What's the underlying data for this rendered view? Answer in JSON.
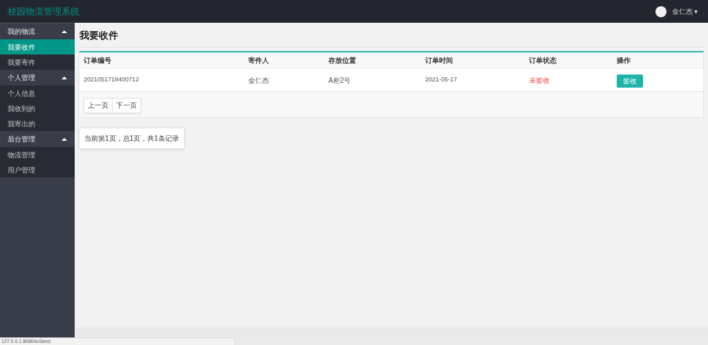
{
  "header": {
    "title": "校园物流管理系统",
    "user": "金仁杰",
    "caret": "▾"
  },
  "sidebar": {
    "groups": [
      {
        "label": "我的物流",
        "expanded": true,
        "items": [
          {
            "label": "我要收件",
            "selected": true
          },
          {
            "label": "我要寄件",
            "selected": false
          }
        ]
      },
      {
        "label": "个人管理",
        "expanded": true,
        "items": [
          {
            "label": "个人信息",
            "selected": false
          },
          {
            "label": "我收到的",
            "selected": false
          },
          {
            "label": "我寄出的",
            "selected": false
          }
        ]
      },
      {
        "label": "后台管理",
        "expanded": true,
        "items": [
          {
            "label": "物流管理",
            "selected": false
          },
          {
            "label": "用户管理",
            "selected": false
          }
        ]
      }
    ]
  },
  "page_title": "我要收件",
  "table": {
    "columns": [
      "订单编号",
      "寄件人",
      "存放位置",
      "订单时间",
      "订单状态",
      "操作"
    ],
    "rows": [
      {
        "order_no": "2021051719400712",
        "sender": "金仁杰",
        "location": "A柜2号",
        "time": "2021-05-17",
        "status": "未签收",
        "received": false,
        "action": "签收"
      }
    ]
  },
  "pager": {
    "prev": "上一页",
    "next": "下一页",
    "summary": "当前第1页，总1页，共1条记录"
  },
  "status_bar": "127.0.0.1:8080/toSend"
}
